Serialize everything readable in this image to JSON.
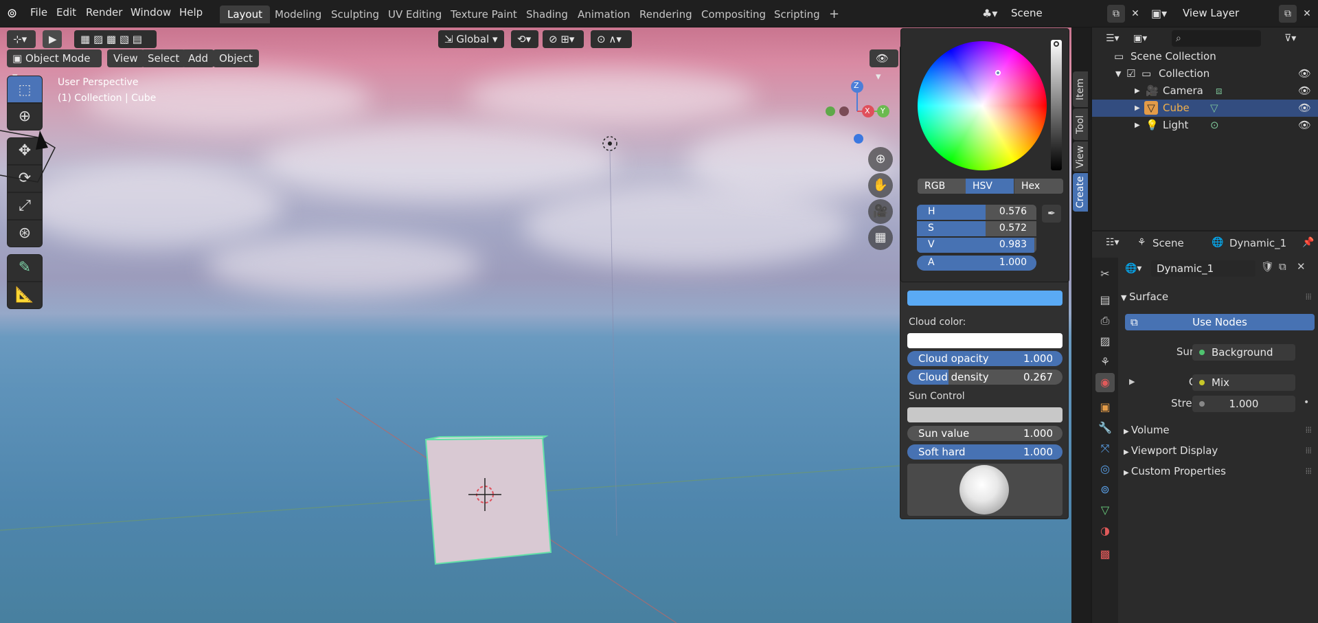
{
  "topbar": {
    "menus": [
      "File",
      "Edit",
      "Render",
      "Window",
      "Help"
    ],
    "workspaces": [
      "Layout",
      "Modeling",
      "Sculpting",
      "UV Editing",
      "Texture Paint",
      "Shading",
      "Animation",
      "Rendering",
      "Compositing",
      "Scripting"
    ],
    "add_tab": "+",
    "scene_name": "Scene",
    "view_layer": "View Layer"
  },
  "viewport": {
    "mode": "Object Mode",
    "menus": [
      "View",
      "Select",
      "Add",
      "Object"
    ],
    "transform_orientation": "Global",
    "info_line1": "User Perspective",
    "info_line2": "(1) Collection | Cube",
    "gizmo": {
      "z": "Z",
      "x": "X",
      "y": "Y"
    }
  },
  "color_picker": {
    "modes": [
      "RGB",
      "HSV",
      "Hex"
    ],
    "active_mode": "HSV",
    "h": {
      "label": "H",
      "value": "0.576",
      "fill": 0.576
    },
    "s": {
      "label": "S",
      "value": "0.572",
      "fill": 0.572
    },
    "v": {
      "label": "V",
      "value": "0.983",
      "fill": 0.983
    },
    "a": {
      "label": "A",
      "value": "1.000",
      "fill": 1.0
    },
    "current_color": "#5aaaf5"
  },
  "side_panel": {
    "cloud_color_label": "Cloud color:",
    "cloud_opacity": {
      "label": "Cloud opacity",
      "value": "1.000",
      "fill": 1.0
    },
    "cloud_density": {
      "label": "Cloud density",
      "value": "0.267",
      "fill": 0.267
    },
    "sun_control_label": "Sun Control",
    "sun_value": {
      "label": "Sun value",
      "value": "1.000",
      "fill": 0.0
    },
    "soft_hard": {
      "label": "Soft hard",
      "value": "1.000",
      "fill": 1.0
    },
    "tabs": [
      "Item",
      "Tool",
      "View",
      "Create"
    ],
    "active_tab": "Create"
  },
  "outliner": {
    "root": "Scene Collection",
    "collection": "Collection",
    "items": [
      {
        "name": "Camera"
      },
      {
        "name": "Cube"
      },
      {
        "name": "Light"
      }
    ]
  },
  "properties": {
    "scene": "Scene",
    "world": "Dynamic_1",
    "world_field": "Dynamic_1",
    "surface_section": "Surface",
    "use_nodes": "Use Nodes",
    "surface_label": "Surface",
    "surface_value": "Background",
    "color_label": "Color",
    "color_value": "Mix",
    "strength_label": "Strength",
    "strength_value": "1.000",
    "sections": [
      "Volume",
      "Viewport Display",
      "Custom Properties"
    ]
  }
}
